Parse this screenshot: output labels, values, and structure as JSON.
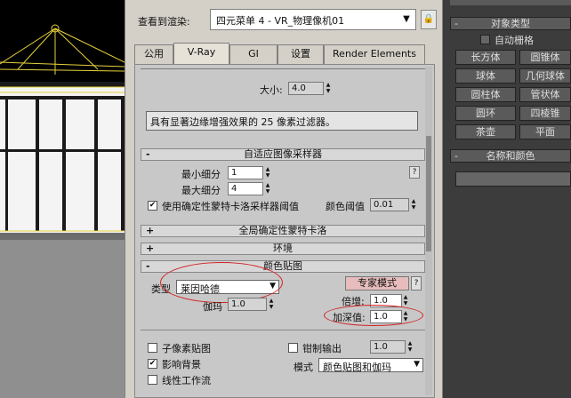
{
  "dialog": {
    "view_label": "查看到渲染:",
    "view_value": "四元菜单 4 - VR_物理像机01",
    "tabs": [
      {
        "label": "公用",
        "active": false
      },
      {
        "label": "V-Ray",
        "active": true
      },
      {
        "label": "GI",
        "active": false
      },
      {
        "label": "设置",
        "active": false
      },
      {
        "label": "Render Elements",
        "active": false
      }
    ]
  },
  "filter": {
    "size_label": "大小:",
    "size_value": "4.0",
    "description": "具有显著边缘增强效果的 25 像素过滤器。"
  },
  "adaptive": {
    "title": "自适应图像采样器",
    "min_label": "最小细分",
    "min_value": "1",
    "max_label": "最大细分",
    "max_value": "4",
    "qmc_label": "使用确定性蒙特卡洛采样器阈值",
    "qmc_checked": true,
    "color_threshold_label": "颜色阈值",
    "color_threshold_value": "0.01",
    "help": "?"
  },
  "global_dmc": {
    "title": "全局确定性蒙特卡洛"
  },
  "environment": {
    "title": "环境"
  },
  "color_mapping": {
    "title": "颜色贴图",
    "type_label": "类型",
    "type_value": "莱因哈德",
    "expert_mode": "专家模式",
    "help": "?",
    "multiplier_label": "倍增:",
    "multiplier_value": "1.0",
    "gamma_label": "伽玛",
    "gamma_value": "1.0",
    "burn_label": "加深值:",
    "burn_value": "1.0",
    "subpixel_label": "子像素贴图",
    "subpixel_checked": false,
    "clamp_label": "钳制输出",
    "clamp_checked": false,
    "clamp_value": "1.0",
    "affect_bg_label": "影响背景",
    "affect_bg_checked": true,
    "mode_label": "模式",
    "mode_value": "颜色贴图和伽玛",
    "linear_label": "线性工作流",
    "linear_checked": false
  },
  "right_panel": {
    "object_type_title": "对象类型",
    "autogrid_label": "自动栅格",
    "buttons": [
      "长方体",
      "圆锥体",
      "球体",
      "几何球体",
      "圆柱体",
      "管状体",
      "圆环",
      "四棱锥",
      "茶壶",
      "平面"
    ],
    "name_color_title": "名称和颜色"
  },
  "colors": {
    "dialog_bg": "#d4d0c8",
    "annotation": "#d32020",
    "expert_btn": "#e7bcbc"
  }
}
